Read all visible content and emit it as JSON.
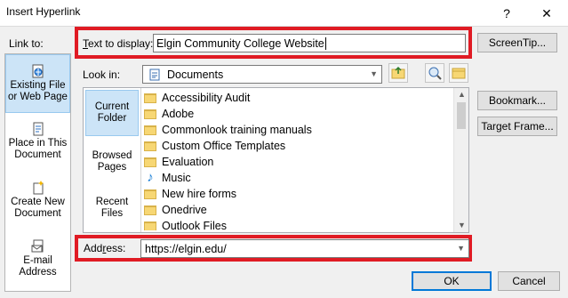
{
  "window": {
    "title": "Insert Hyperlink",
    "help": "?",
    "close": "✕"
  },
  "text_to_display": {
    "label": "Text to display:",
    "value": "Elgin Community College Website"
  },
  "screentip_button": "ScreenTip...",
  "link_to": {
    "label": "Link to:",
    "items": [
      {
        "label_line1": "Existing File",
        "label_line2": "or Web Page"
      },
      {
        "label_line1": "Place in This",
        "label_line2": "Document"
      },
      {
        "label_line1": "Create New",
        "label_line2": "Document"
      },
      {
        "label_line1": "E-mail",
        "label_line2": "Address"
      }
    ]
  },
  "look_in": {
    "label": "Look in:",
    "value": "Documents"
  },
  "tabs": [
    {
      "line1": "Current",
      "line2": "Folder"
    },
    {
      "line1": "Browsed",
      "line2": "Pages"
    },
    {
      "line1": "Recent",
      "line2": "Files"
    }
  ],
  "files": [
    "Accessibility Audit",
    "Adobe",
    "Commonlook training manuals",
    "Custom Office Templates",
    "Evaluation",
    "Music",
    "New hire forms",
    "Onedrive",
    "Outlook Files"
  ],
  "buttons": {
    "bookmark": "Bookmark...",
    "target_frame": "Target Frame...",
    "ok": "OK",
    "cancel": "Cancel"
  },
  "address": {
    "label": "Address:",
    "value": "https://elgin.edu/"
  },
  "colors": {
    "highlight": "#e01b24",
    "selection": "#cce4f7",
    "accent": "#0078d7"
  }
}
